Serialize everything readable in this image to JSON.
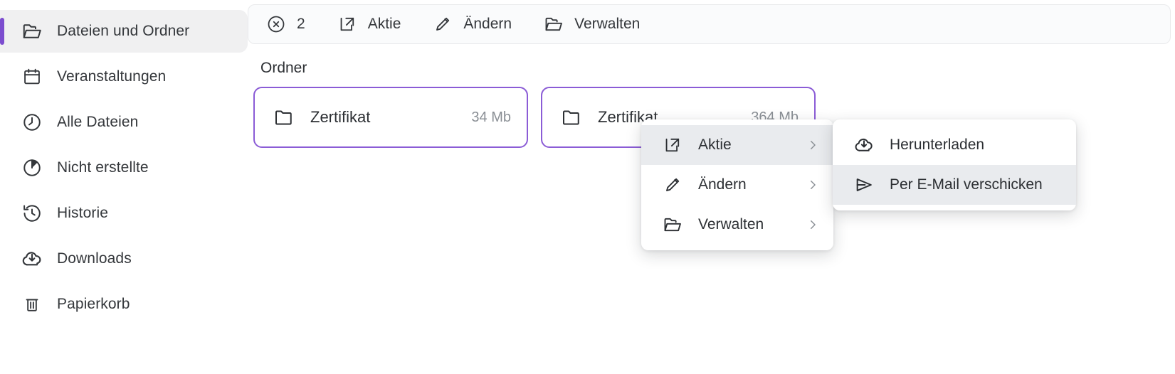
{
  "sidebar": {
    "items": [
      {
        "label": "Dateien und Ordner",
        "icon": "folder-open-icon",
        "active": true
      },
      {
        "label": "Veranstaltungen",
        "icon": "calendar-icon",
        "active": false
      },
      {
        "label": "Alle Dateien",
        "icon": "clock-icon",
        "active": false
      },
      {
        "label": "Nicht erstellte",
        "icon": "pie-chart-icon",
        "active": false
      },
      {
        "label": "Historie",
        "icon": "history-icon",
        "active": false
      },
      {
        "label": "Downloads",
        "icon": "cloud-download-icon",
        "active": false
      },
      {
        "label": "Papierkorb",
        "icon": "trash-icon",
        "active": false
      }
    ]
  },
  "toolbar": {
    "selection_count": "2",
    "clear_icon": "circle-x-icon",
    "actions": [
      {
        "label": "Aktie",
        "icon": "share-icon"
      },
      {
        "label": "Ändern",
        "icon": "pencil-icon"
      },
      {
        "label": "Verwalten",
        "icon": "folder-open-icon"
      }
    ]
  },
  "main": {
    "section_title": "Ordner",
    "folders": [
      {
        "name": "Zertifikat",
        "size": "34 Mb",
        "icon": "folder-icon"
      },
      {
        "name": "Zertifikat",
        "size": "364 Mb",
        "icon": "folder-icon"
      }
    ]
  },
  "context_menu": {
    "items": [
      {
        "label": "Aktie",
        "icon": "share-icon",
        "highlighted": true,
        "arrow": "chevron-right-icon"
      },
      {
        "label": "Ändern",
        "icon": "pencil-icon",
        "highlighted": false,
        "arrow": "chevron-right-icon"
      },
      {
        "label": "Verwalten",
        "icon": "folder-open-icon",
        "highlighted": false,
        "arrow": "chevron-right-icon"
      }
    ]
  },
  "submenu": {
    "items": [
      {
        "label": "Herunterladen",
        "icon": "cloud-download-icon",
        "highlighted": false
      },
      {
        "label": "Per E-Mail verschicken",
        "icon": "send-icon",
        "highlighted": true
      }
    ]
  },
  "colors": {
    "accent": "#7c4dcf",
    "card_border": "#8b5cd6",
    "active_nav_bg": "#f0f0f1",
    "menu_highlight": "#e9ebee",
    "toolbar_bg": "#fafbfc",
    "muted_text": "#8a8f95"
  }
}
